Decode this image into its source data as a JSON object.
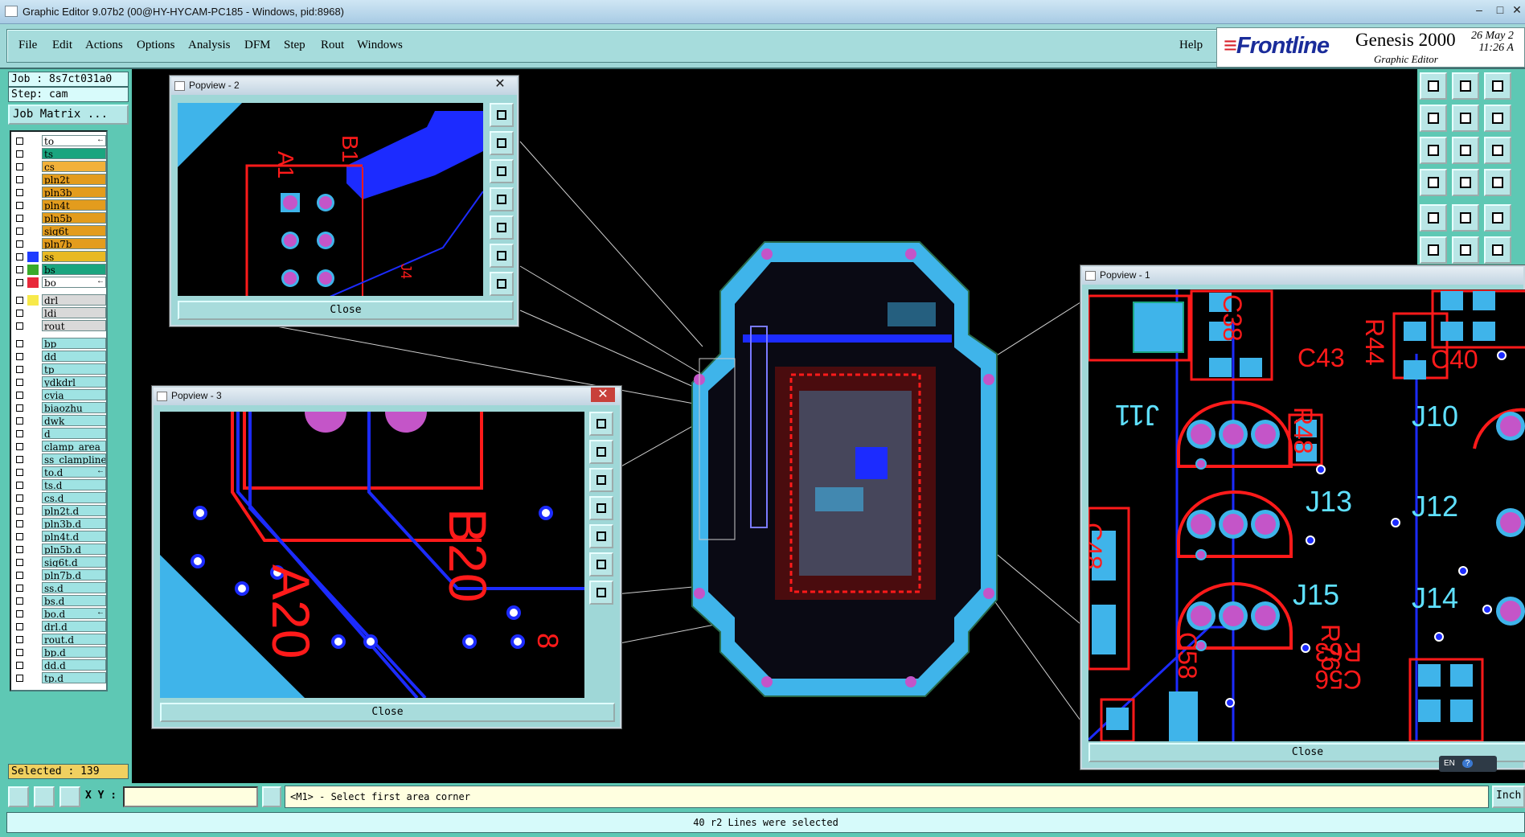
{
  "window": {
    "title": "Graphic Editor 9.07b2 (00@HY-HYCAM-PC185 - Windows, pid:8968)",
    "min": "–",
    "max": "□",
    "close": "✕"
  },
  "menu": {
    "items": [
      "File",
      "Edit",
      "Actions",
      "Options",
      "Analysis",
      "DFM",
      "Step",
      "Rout",
      "Windows"
    ],
    "help": "Help"
  },
  "logo": {
    "brand_prefix": "≡",
    "brand": "Frontline",
    "product": "Genesis 2000",
    "subtitle": "Graphic Editor",
    "date": "26 May 2",
    "time": "11:26 A"
  },
  "job": {
    "job": "Job : 8s7ct031a0",
    "step": "Step: cam",
    "matrix_button": "Job Matrix ..."
  },
  "layers": [
    {
      "name": "to",
      "color": "#ffffff",
      "swatch": "",
      "flag": "←"
    },
    {
      "name": "ts",
      "color": "#1aa57f",
      "swatch": ""
    },
    {
      "name": "cs",
      "color": "#f2b13a",
      "swatch": ""
    },
    {
      "name": "pln2t",
      "color": "#e39c1d",
      "swatch": ""
    },
    {
      "name": "pln3b",
      "color": "#e39c1d",
      "swatch": ""
    },
    {
      "name": "pln4t",
      "color": "#e39c1d",
      "swatch": ""
    },
    {
      "name": "pln5b",
      "color": "#e39c1d",
      "swatch": ""
    },
    {
      "name": "sig6t",
      "color": "#e39c1d",
      "swatch": ""
    },
    {
      "name": "pln7b",
      "color": "#e39c1d",
      "swatch": ""
    },
    {
      "name": "ss",
      "color": "#e8b923",
      "swatch": "#1f3cff"
    },
    {
      "name": "bs",
      "color": "#1aa57f",
      "swatch": "#3aaa2a"
    },
    {
      "name": "bo",
      "color": "#ffffff",
      "swatch": "#e8283a",
      "flag": "←"
    },
    {
      "name": "drl",
      "color": "#d9d9d9",
      "swatch": "#f7e94a"
    },
    {
      "name": "ldi",
      "color": "#d9d9d9",
      "swatch": ""
    },
    {
      "name": "rout",
      "color": "#d9d9d9",
      "swatch": ""
    },
    {
      "name": "bp",
      "color": "#9fe3e3",
      "swatch": ""
    },
    {
      "name": "dd",
      "color": "#9fe3e3",
      "swatch": ""
    },
    {
      "name": "tp",
      "color": "#9fe3e3",
      "swatch": ""
    },
    {
      "name": "ydkdrl",
      "color": "#9fe3e3",
      "swatch": ""
    },
    {
      "name": "cvia",
      "color": "#9fe3e3",
      "swatch": ""
    },
    {
      "name": "biaozhu",
      "color": "#9fe3e3",
      "swatch": ""
    },
    {
      "name": "dwk",
      "color": "#9fe3e3",
      "swatch": ""
    },
    {
      "name": "d",
      "color": "#9fe3e3",
      "swatch": ""
    },
    {
      "name": "clamp_area",
      "color": "#9fe3e3",
      "swatch": ""
    },
    {
      "name": "ss_clampline",
      "color": "#9fe3e3",
      "swatch": ""
    },
    {
      "name": "to.d",
      "color": "#9fe3e3",
      "swatch": "",
      "flag": "←"
    },
    {
      "name": "ts.d",
      "color": "#9fe3e3",
      "swatch": ""
    },
    {
      "name": "cs.d",
      "color": "#9fe3e3",
      "swatch": ""
    },
    {
      "name": "pln2t.d",
      "color": "#9fe3e3",
      "swatch": ""
    },
    {
      "name": "pln3b.d",
      "color": "#9fe3e3",
      "swatch": ""
    },
    {
      "name": "pln4t.d",
      "color": "#9fe3e3",
      "swatch": ""
    },
    {
      "name": "pln5b.d",
      "color": "#9fe3e3",
      "swatch": ""
    },
    {
      "name": "sig6t.d",
      "color": "#9fe3e3",
      "swatch": ""
    },
    {
      "name": "pln7b.d",
      "color": "#9fe3e3",
      "swatch": ""
    },
    {
      "name": "ss.d",
      "color": "#9fe3e3",
      "swatch": ""
    },
    {
      "name": "bs.d",
      "color": "#9fe3e3",
      "swatch": ""
    },
    {
      "name": "bo.d",
      "color": "#9fe3e3",
      "swatch": "",
      "flag": "←"
    },
    {
      "name": "drl.d",
      "color": "#9fe3e3",
      "swatch": ""
    },
    {
      "name": "rout.d",
      "color": "#9fe3e3",
      "swatch": ""
    },
    {
      "name": "bp.d",
      "color": "#9fe3e3",
      "swatch": ""
    },
    {
      "name": "dd.d",
      "color": "#9fe3e3",
      "swatch": ""
    },
    {
      "name": "tp.d",
      "color": "#9fe3e3",
      "swatch": ""
    }
  ],
  "selected": "Selected : 139",
  "popviews": {
    "p1": {
      "title": "Popview - 1",
      "close": "Close"
    },
    "p2": {
      "title": "Popview - 2",
      "close": "Close",
      "x": "✕"
    },
    "p3": {
      "title": "Popview - 3",
      "close": "Close",
      "x": "✕"
    }
  },
  "refdes": {
    "p2": [
      "A1",
      "B1",
      "J4"
    ],
    "p3": [
      "A20",
      "B20",
      "8"
    ],
    "p1": [
      "C38",
      "R44",
      "C43",
      "C40",
      "J11",
      "J10",
      "R48",
      "J13",
      "J12",
      "C48",
      "J15",
      "J14",
      "R63",
      "R76",
      "C58",
      "C56"
    ]
  },
  "bottom": {
    "xy_label": "X Y :",
    "xy_value": "",
    "prompt": "<M1> - Select first area corner",
    "units": "Inch",
    "status": "40 r2 Lines were selected"
  },
  "tray": {
    "lang": "EN",
    "help": "?"
  },
  "colors": {
    "panel": "#9fd7d7",
    "sidebar": "#5ec8b4",
    "copper_red": "#ff1a1a",
    "pad_cyan": "#3fb4ea",
    "via_magenta": "#c455c8",
    "trace_blue": "#1c2bff"
  }
}
